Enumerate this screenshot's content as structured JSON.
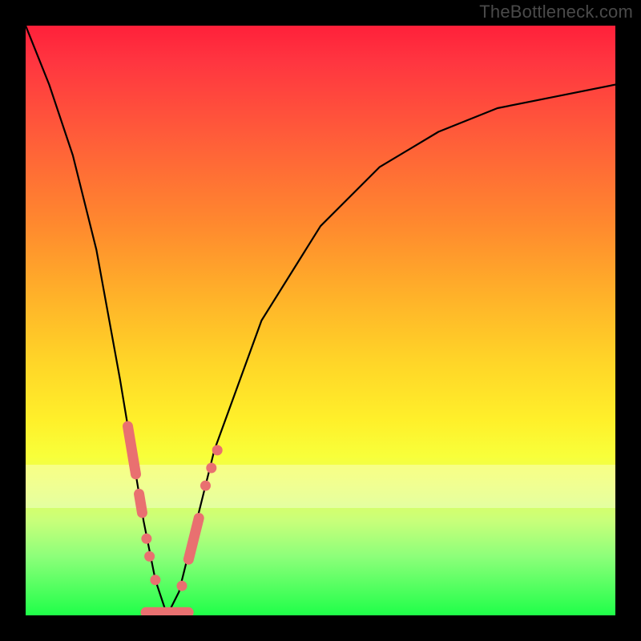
{
  "watermark": "TheBottleneck.com",
  "colors": {
    "background": "#000000",
    "watermark": "#4a4a4a",
    "curve": "#000000",
    "marker": "#e97070"
  },
  "chart_data": {
    "type": "line",
    "title": "",
    "xlabel": "",
    "ylabel": "",
    "xlim": [
      0,
      100
    ],
    "ylim": [
      0,
      100
    ],
    "grid": false,
    "note": "Bottleneck-style V-curve; x axis is component balance parameter (arbitrary, no ticks shown), y axis is bottleneck percentage (arbitrary, no ticks shown). Minimum ≈ at x ≈ 24, y ≈ 0. Values estimated from pixel positions.",
    "series": [
      {
        "name": "bottleneck-curve",
        "x": [
          0,
          4,
          8,
          12,
          16,
          18,
          20,
          22,
          24,
          26,
          28,
          32,
          40,
          50,
          60,
          70,
          80,
          90,
          100
        ],
        "y": [
          100,
          90,
          78,
          62,
          40,
          28,
          16,
          6,
          0,
          4,
          12,
          28,
          50,
          66,
          76,
          82,
          86,
          88,
          90
        ]
      }
    ],
    "markers": [
      {
        "name": "left-cluster",
        "shape": "pill",
        "x": 18.0,
        "y": 28,
        "len": 10
      },
      {
        "name": "left-cluster",
        "shape": "pill",
        "x": 19.5,
        "y": 19,
        "len": 5
      },
      {
        "name": "left-cluster",
        "shape": "circle",
        "x": 20.5,
        "y": 13
      },
      {
        "name": "left-cluster",
        "shape": "circle",
        "x": 21.0,
        "y": 10
      },
      {
        "name": "left-cluster",
        "shape": "circle",
        "x": 22.0,
        "y": 6
      },
      {
        "name": "bottom",
        "shape": "pill",
        "x": 24.0,
        "y": 0.5,
        "len": 9,
        "horizontal": true
      },
      {
        "name": "right-cluster",
        "shape": "circle",
        "x": 26.5,
        "y": 5
      },
      {
        "name": "right-cluster",
        "shape": "pill",
        "x": 28.5,
        "y": 13,
        "len": 9
      },
      {
        "name": "right-cluster",
        "shape": "circle",
        "x": 30.5,
        "y": 22
      },
      {
        "name": "right-cluster",
        "shape": "circle",
        "x": 31.5,
        "y": 25
      },
      {
        "name": "right-cluster",
        "shape": "circle",
        "x": 32.5,
        "y": 28
      }
    ]
  }
}
